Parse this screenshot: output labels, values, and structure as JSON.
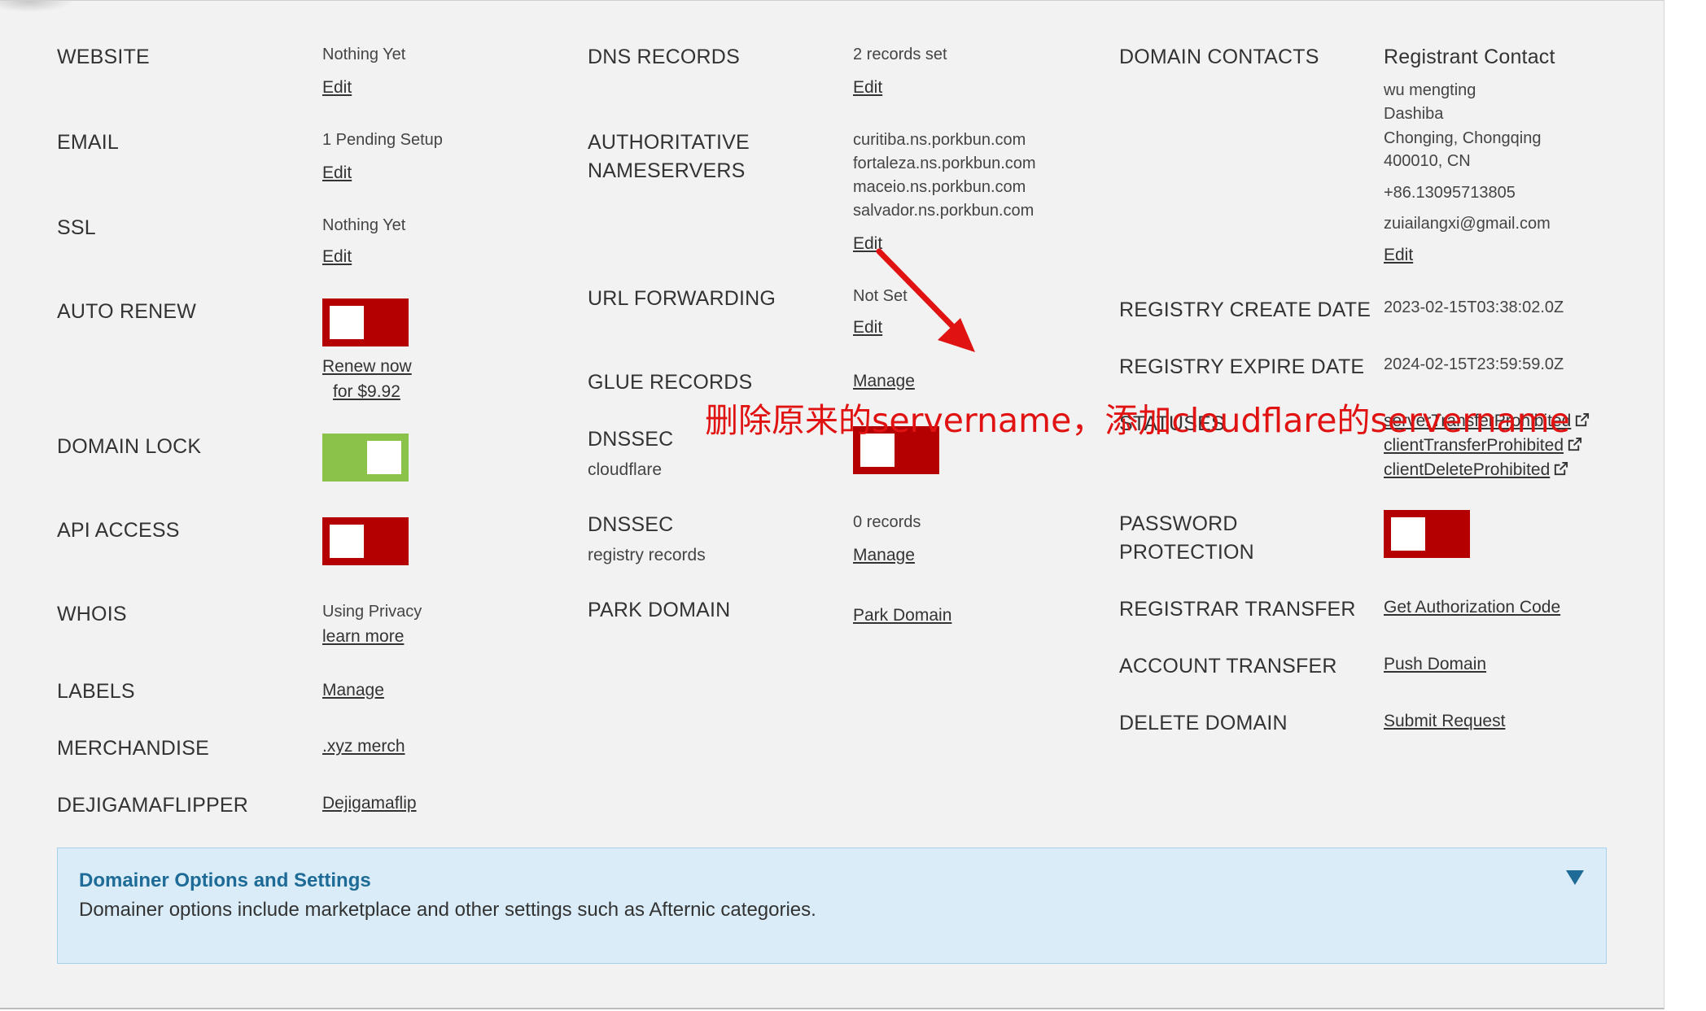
{
  "left": {
    "website": {
      "label": "WEBSITE",
      "value": "Nothing Yet",
      "link": "Edit"
    },
    "email": {
      "label": "EMAIL",
      "value": "1 Pending Setup",
      "link": "Edit"
    },
    "ssl": {
      "label": "SSL",
      "value": "Nothing Yet",
      "link": "Edit"
    },
    "auto_renew": {
      "label": "AUTO RENEW",
      "state": "off",
      "renew_line1": "Renew now",
      "renew_line2": "for $9.92"
    },
    "domain_lock": {
      "label": "DOMAIN LOCK",
      "state": "on"
    },
    "api_access": {
      "label": "API ACCESS",
      "state": "off"
    },
    "whois": {
      "label": "WHOIS",
      "value": "Using Privacy",
      "link": "learn more"
    },
    "labels": {
      "label": "LABELS",
      "link": "Manage"
    },
    "merchandise": {
      "label": "MERCHANDISE",
      "link": ".xyz merch"
    },
    "dejigamaflipper": {
      "label": "DEJIGAMAFLIPPER",
      "link": "Dejigamaflip"
    }
  },
  "middle": {
    "dns_records": {
      "label": "DNS RECORDS",
      "value": "2 records set",
      "link": "Edit"
    },
    "nameservers": {
      "label_line1": "AUTHORITATIVE",
      "label_line2": "NAMESERVERS",
      "servers": [
        "curitiba.ns.porkbun.com",
        "fortaleza.ns.porkbun.com",
        "maceio.ns.porkbun.com",
        "salvador.ns.porkbun.com"
      ],
      "link": "Edit"
    },
    "url_forwarding": {
      "label": "URL FORWARDING",
      "value": "Not Set",
      "link": "Edit"
    },
    "glue_records": {
      "label": "GLUE RECORDS",
      "link": "Manage"
    },
    "dnssec_cloudflare": {
      "label": "DNSSEC",
      "sub": "cloudflare",
      "state": "off"
    },
    "dnssec_registry": {
      "label": "DNSSEC",
      "sub": "registry records",
      "value": "0 records",
      "link": "Manage"
    },
    "park_domain": {
      "label": "PARK DOMAIN",
      "link": "Park Domain"
    }
  },
  "right": {
    "contacts": {
      "label": "DOMAIN CONTACTS",
      "title": "Registrant Contact",
      "lines": [
        "wu mengting",
        "Dashiba",
        "Chonging, Chongqing",
        "400010, CN"
      ],
      "phone": "+86.13095713805",
      "email": "zuiailangxi@gmail.com",
      "link": "Edit"
    },
    "create_date": {
      "label": "REGISTRY CREATE DATE",
      "value": "2023-02-15T03:38:02.0Z"
    },
    "expire_date": {
      "label": "REGISTRY EXPIRE DATE",
      "value": "2024-02-15T23:59:59.0Z"
    },
    "statuses": {
      "label": "STATUSES",
      "items": [
        "serverTransferProhibited",
        "clientTransferProhibited",
        "clientDeleteProhibited"
      ]
    },
    "password_protection": {
      "label_line1": "PASSWORD",
      "label_line2": "PROTECTION",
      "state": "off"
    },
    "registrar_transfer": {
      "label": "REGISTRAR TRANSFER",
      "link": "Get Authorization Code"
    },
    "account_transfer": {
      "label": "ACCOUNT TRANSFER",
      "link": "Push Domain"
    },
    "delete_domain": {
      "label": "DELETE DOMAIN",
      "link": "Submit Request"
    }
  },
  "domainer": {
    "title": "Domainer Options and Settings",
    "description": "Domainer options include marketplace and other settings such as Afternic categories.",
    "icon": "chevron-down-icon"
  },
  "annotation": {
    "text": "删除原来的servername，添加cloudflare的servername",
    "color": "#e01212"
  },
  "colors": {
    "toggle_off": "#b40000",
    "toggle_on": "#8bc34a",
    "panel_bg": "#f2f2f2",
    "info_bg": "#d9ecf7",
    "info_title": "#1d6b96"
  }
}
